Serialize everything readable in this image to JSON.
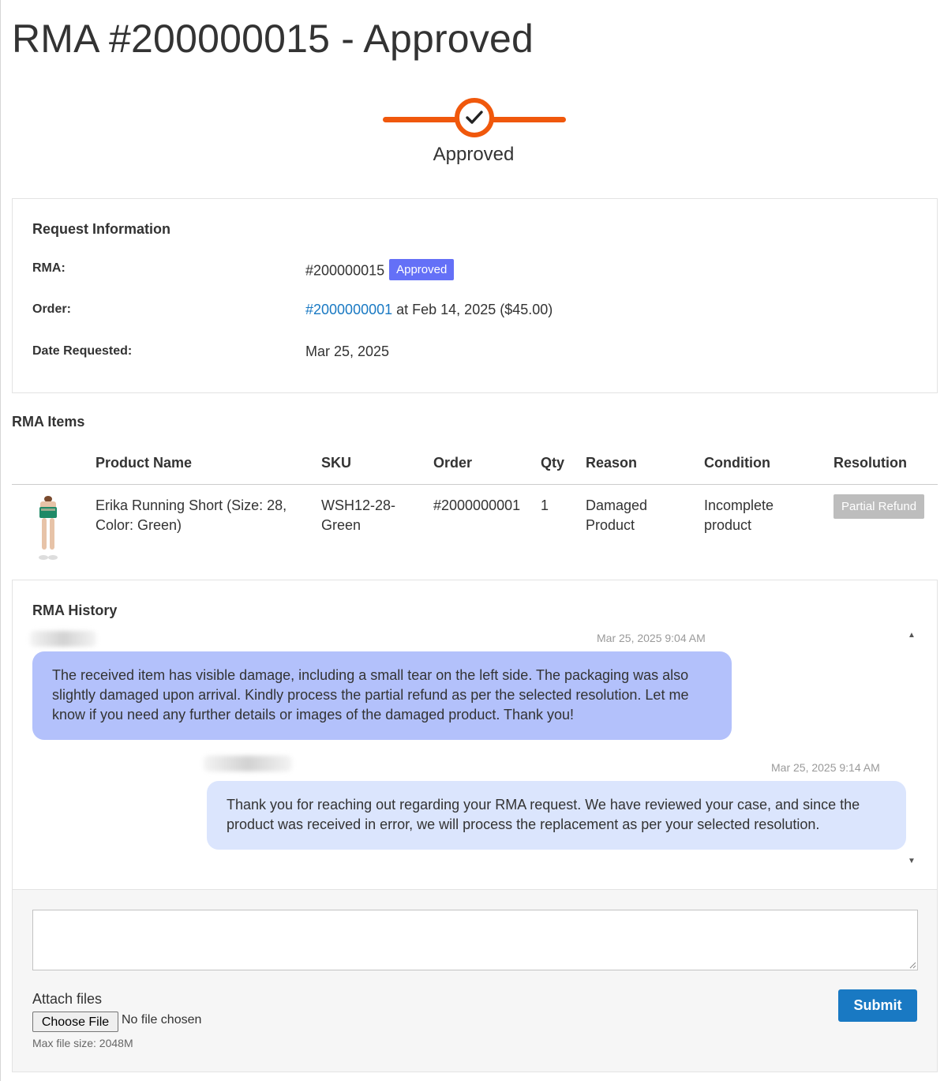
{
  "page": {
    "title": "RMA #200000015 - Approved"
  },
  "progress": {
    "status_label": "Approved",
    "accent_color": "#f0580c",
    "icon": "checkmark-icon"
  },
  "request_info": {
    "title": "Request Information",
    "rma_label": "RMA:",
    "rma_value": "#200000015",
    "rma_status": "Approved",
    "order_label": "Order:",
    "order_link": "#2000000001",
    "order_suffix": " at Feb 14, 2025 ($45.00)",
    "date_label": "Date Requested:",
    "date_value": "Mar 25, 2025"
  },
  "rma_items": {
    "title": "RMA Items",
    "columns": [
      "Product Name",
      "SKU",
      "Order",
      "Qty",
      "Reason",
      "Condition",
      "Resolution"
    ],
    "rows": [
      {
        "product_name": "Erika Running Short (Size: 28, Color: Green)",
        "sku": "WSH12-28-Green",
        "order": "#2000000001",
        "qty": "1",
        "reason": "Damaged Product",
        "condition": "Incomplete product",
        "resolution": "Partial Refund"
      }
    ]
  },
  "history": {
    "title": "RMA History",
    "messages": [
      {
        "time": "Mar 25, 2025 9:04 AM",
        "text": "The received item has visible damage, including a small tear on the left side. The packaging was also slightly damaged upon arrival. Kindly process the partial refund as per the selected resolution. Let me know if you need any further details or images of the damaged product. Thank you!"
      },
      {
        "time": "Mar 25, 2025 9:14 AM",
        "text": "Thank you for reaching out regarding your RMA request. We have reviewed your case, and since the product was received in error, we will process the replacement as per your selected resolution."
      }
    ]
  },
  "reply": {
    "attach_label": "Attach files",
    "choose_file": "Choose File",
    "no_file": "No file chosen",
    "max_size": "Max file size: 2048M",
    "submit": "Submit"
  }
}
